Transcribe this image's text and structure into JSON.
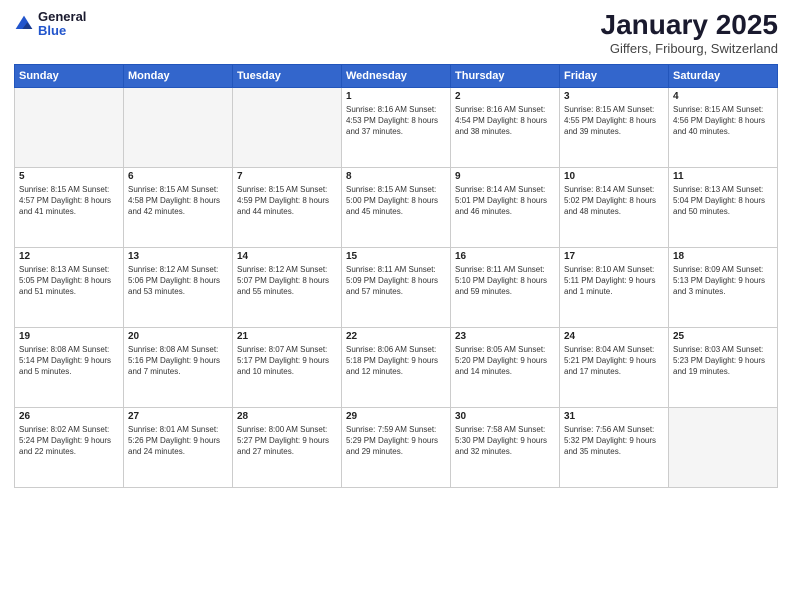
{
  "header": {
    "logo_general": "General",
    "logo_blue": "Blue",
    "month": "January 2025",
    "location": "Giffers, Fribourg, Switzerland"
  },
  "weekdays": [
    "Sunday",
    "Monday",
    "Tuesday",
    "Wednesday",
    "Thursday",
    "Friday",
    "Saturday"
  ],
  "weeks": [
    [
      {
        "day": "",
        "info": ""
      },
      {
        "day": "",
        "info": ""
      },
      {
        "day": "",
        "info": ""
      },
      {
        "day": "1",
        "info": "Sunrise: 8:16 AM\nSunset: 4:53 PM\nDaylight: 8 hours and 37 minutes."
      },
      {
        "day": "2",
        "info": "Sunrise: 8:16 AM\nSunset: 4:54 PM\nDaylight: 8 hours and 38 minutes."
      },
      {
        "day": "3",
        "info": "Sunrise: 8:15 AM\nSunset: 4:55 PM\nDaylight: 8 hours and 39 minutes."
      },
      {
        "day": "4",
        "info": "Sunrise: 8:15 AM\nSunset: 4:56 PM\nDaylight: 8 hours and 40 minutes."
      }
    ],
    [
      {
        "day": "5",
        "info": "Sunrise: 8:15 AM\nSunset: 4:57 PM\nDaylight: 8 hours and 41 minutes."
      },
      {
        "day": "6",
        "info": "Sunrise: 8:15 AM\nSunset: 4:58 PM\nDaylight: 8 hours and 42 minutes."
      },
      {
        "day": "7",
        "info": "Sunrise: 8:15 AM\nSunset: 4:59 PM\nDaylight: 8 hours and 44 minutes."
      },
      {
        "day": "8",
        "info": "Sunrise: 8:15 AM\nSunset: 5:00 PM\nDaylight: 8 hours and 45 minutes."
      },
      {
        "day": "9",
        "info": "Sunrise: 8:14 AM\nSunset: 5:01 PM\nDaylight: 8 hours and 46 minutes."
      },
      {
        "day": "10",
        "info": "Sunrise: 8:14 AM\nSunset: 5:02 PM\nDaylight: 8 hours and 48 minutes."
      },
      {
        "day": "11",
        "info": "Sunrise: 8:13 AM\nSunset: 5:04 PM\nDaylight: 8 hours and 50 minutes."
      }
    ],
    [
      {
        "day": "12",
        "info": "Sunrise: 8:13 AM\nSunset: 5:05 PM\nDaylight: 8 hours and 51 minutes."
      },
      {
        "day": "13",
        "info": "Sunrise: 8:12 AM\nSunset: 5:06 PM\nDaylight: 8 hours and 53 minutes."
      },
      {
        "day": "14",
        "info": "Sunrise: 8:12 AM\nSunset: 5:07 PM\nDaylight: 8 hours and 55 minutes."
      },
      {
        "day": "15",
        "info": "Sunrise: 8:11 AM\nSunset: 5:09 PM\nDaylight: 8 hours and 57 minutes."
      },
      {
        "day": "16",
        "info": "Sunrise: 8:11 AM\nSunset: 5:10 PM\nDaylight: 8 hours and 59 minutes."
      },
      {
        "day": "17",
        "info": "Sunrise: 8:10 AM\nSunset: 5:11 PM\nDaylight: 9 hours and 1 minute."
      },
      {
        "day": "18",
        "info": "Sunrise: 8:09 AM\nSunset: 5:13 PM\nDaylight: 9 hours and 3 minutes."
      }
    ],
    [
      {
        "day": "19",
        "info": "Sunrise: 8:08 AM\nSunset: 5:14 PM\nDaylight: 9 hours and 5 minutes."
      },
      {
        "day": "20",
        "info": "Sunrise: 8:08 AM\nSunset: 5:16 PM\nDaylight: 9 hours and 7 minutes."
      },
      {
        "day": "21",
        "info": "Sunrise: 8:07 AM\nSunset: 5:17 PM\nDaylight: 9 hours and 10 minutes."
      },
      {
        "day": "22",
        "info": "Sunrise: 8:06 AM\nSunset: 5:18 PM\nDaylight: 9 hours and 12 minutes."
      },
      {
        "day": "23",
        "info": "Sunrise: 8:05 AM\nSunset: 5:20 PM\nDaylight: 9 hours and 14 minutes."
      },
      {
        "day": "24",
        "info": "Sunrise: 8:04 AM\nSunset: 5:21 PM\nDaylight: 9 hours and 17 minutes."
      },
      {
        "day": "25",
        "info": "Sunrise: 8:03 AM\nSunset: 5:23 PM\nDaylight: 9 hours and 19 minutes."
      }
    ],
    [
      {
        "day": "26",
        "info": "Sunrise: 8:02 AM\nSunset: 5:24 PM\nDaylight: 9 hours and 22 minutes."
      },
      {
        "day": "27",
        "info": "Sunrise: 8:01 AM\nSunset: 5:26 PM\nDaylight: 9 hours and 24 minutes."
      },
      {
        "day": "28",
        "info": "Sunrise: 8:00 AM\nSunset: 5:27 PM\nDaylight: 9 hours and 27 minutes."
      },
      {
        "day": "29",
        "info": "Sunrise: 7:59 AM\nSunset: 5:29 PM\nDaylight: 9 hours and 29 minutes."
      },
      {
        "day": "30",
        "info": "Sunrise: 7:58 AM\nSunset: 5:30 PM\nDaylight: 9 hours and 32 minutes."
      },
      {
        "day": "31",
        "info": "Sunrise: 7:56 AM\nSunset: 5:32 PM\nDaylight: 9 hours and 35 minutes."
      },
      {
        "day": "",
        "info": ""
      }
    ]
  ]
}
